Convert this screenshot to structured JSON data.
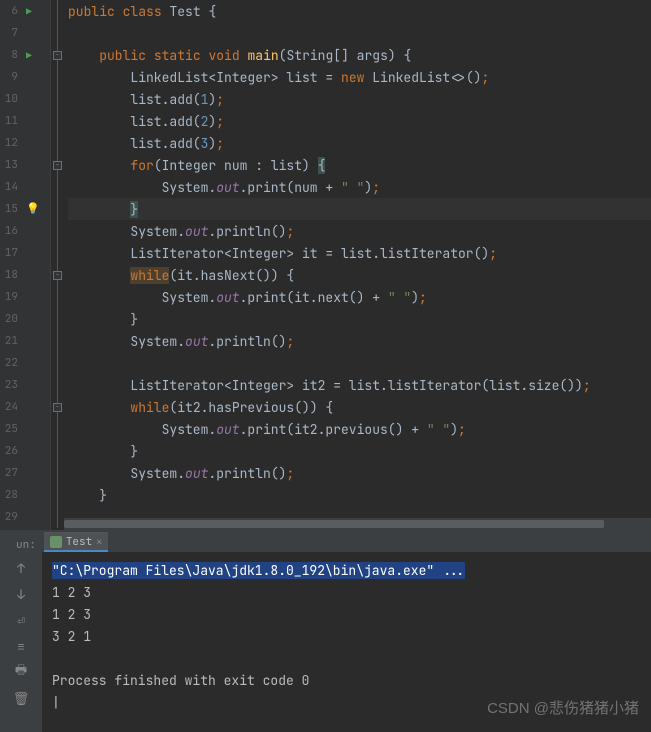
{
  "lines": [
    {
      "n": "6",
      "run": true,
      "code": [
        [
          "kw",
          "public"
        ],
        [
          "punc",
          " "
        ],
        [
          "kw",
          "class"
        ],
        [
          "punc",
          " "
        ],
        [
          "cls",
          "Test"
        ],
        [
          "punc",
          " {"
        ]
      ]
    },
    {
      "n": "7",
      "code": []
    },
    {
      "n": "8",
      "run": true,
      "fold": true,
      "code": [
        [
          "punc",
          "    "
        ],
        [
          "kw",
          "public"
        ],
        [
          "punc",
          " "
        ],
        [
          "kw",
          "static"
        ],
        [
          "punc",
          " "
        ],
        [
          "kw",
          "void"
        ],
        [
          "punc",
          " "
        ],
        [
          "method",
          "main"
        ],
        [
          "punc",
          "(String[] args) {"
        ]
      ]
    },
    {
      "n": "9",
      "code": [
        [
          "punc",
          "        LinkedList<Integer> list = "
        ],
        [
          "kw",
          "new"
        ],
        [
          "punc",
          " LinkedList<>()"
        ],
        [
          "semi",
          ";"
        ]
      ]
    },
    {
      "n": "10",
      "code": [
        [
          "punc",
          "        list.add("
        ],
        [
          "num",
          "1"
        ],
        [
          "punc",
          ")"
        ],
        [
          "semi",
          ";"
        ]
      ]
    },
    {
      "n": "11",
      "code": [
        [
          "punc",
          "        list.add("
        ],
        [
          "num",
          "2"
        ],
        [
          "punc",
          ")"
        ],
        [
          "semi",
          ";"
        ]
      ]
    },
    {
      "n": "12",
      "code": [
        [
          "punc",
          "        list.add("
        ],
        [
          "num",
          "3"
        ],
        [
          "punc",
          ")"
        ],
        [
          "semi",
          ";"
        ]
      ]
    },
    {
      "n": "13",
      "fold": true,
      "code": [
        [
          "punc",
          "        "
        ],
        [
          "kw",
          "for"
        ],
        [
          "punc",
          "(Integer num : list) "
        ],
        [
          "hlbr",
          "{"
        ]
      ]
    },
    {
      "n": "14",
      "code": [
        [
          "punc",
          "            System."
        ],
        [
          "field",
          "out"
        ],
        [
          "punc",
          ".print(num + "
        ],
        [
          "str",
          "\" \""
        ],
        [
          "punc",
          ")"
        ],
        [
          "semi",
          ";"
        ]
      ]
    },
    {
      "n": "15",
      "bulb": true,
      "hl": true,
      "code": [
        [
          "punc",
          "        "
        ],
        [
          "hlbr",
          "}"
        ]
      ]
    },
    {
      "n": "16",
      "code": [
        [
          "punc",
          "        System."
        ],
        [
          "field",
          "out"
        ],
        [
          "punc",
          ".println()"
        ],
        [
          "semi",
          ";"
        ]
      ]
    },
    {
      "n": "17",
      "code": [
        [
          "punc",
          "        ListIterator<Integer> it = list.listIterator()"
        ],
        [
          "semi",
          ";"
        ]
      ]
    },
    {
      "n": "18",
      "fold": true,
      "code": [
        [
          "punc",
          "        "
        ],
        [
          "hlkw",
          "while"
        ],
        [
          "punc",
          "(it.hasNext()) {"
        ]
      ]
    },
    {
      "n": "19",
      "code": [
        [
          "punc",
          "            System."
        ],
        [
          "field",
          "out"
        ],
        [
          "punc",
          ".print(it.next() + "
        ],
        [
          "str",
          "\" \""
        ],
        [
          "punc",
          ")"
        ],
        [
          "semi",
          ";"
        ]
      ]
    },
    {
      "n": "20",
      "code": [
        [
          "punc",
          "        }"
        ]
      ]
    },
    {
      "n": "21",
      "code": [
        [
          "punc",
          "        System."
        ],
        [
          "field",
          "out"
        ],
        [
          "punc",
          ".println()"
        ],
        [
          "semi",
          ";"
        ]
      ]
    },
    {
      "n": "22",
      "code": []
    },
    {
      "n": "23",
      "code": [
        [
          "punc",
          "        ListIterator<Integer> it2 = list.listIterator(list.size())"
        ],
        [
          "semi",
          ";"
        ]
      ]
    },
    {
      "n": "24",
      "fold": true,
      "code": [
        [
          "punc",
          "        "
        ],
        [
          "kw",
          "while"
        ],
        [
          "punc",
          "(it2.hasPrevious()) {"
        ]
      ]
    },
    {
      "n": "25",
      "code": [
        [
          "punc",
          "            System."
        ],
        [
          "field",
          "out"
        ],
        [
          "punc",
          ".print(it2.previous() + "
        ],
        [
          "str",
          "\" \""
        ],
        [
          "punc",
          ")"
        ],
        [
          "semi",
          ";"
        ]
      ]
    },
    {
      "n": "26",
      "code": [
        [
          "punc",
          "        }"
        ]
      ]
    },
    {
      "n": "27",
      "code": [
        [
          "punc",
          "        System."
        ],
        [
          "field",
          "out"
        ],
        [
          "punc",
          ".println()"
        ],
        [
          "semi",
          ";"
        ]
      ]
    },
    {
      "n": "28",
      "code": [
        [
          "punc",
          "    }"
        ]
      ]
    },
    {
      "n": "29",
      "code": []
    }
  ],
  "runTab": {
    "label": "Test"
  },
  "runLabel": "un:",
  "console": {
    "cmd": "\"C:\\Program Files\\Java\\jdk1.8.0_192\\bin\\java.exe\" ...",
    "out": [
      "1 2 3",
      "1 2 3",
      "3 2 1",
      "",
      "Process finished with exit code 0"
    ]
  },
  "watermark": "CSDN @悲伤猪猪小猪"
}
